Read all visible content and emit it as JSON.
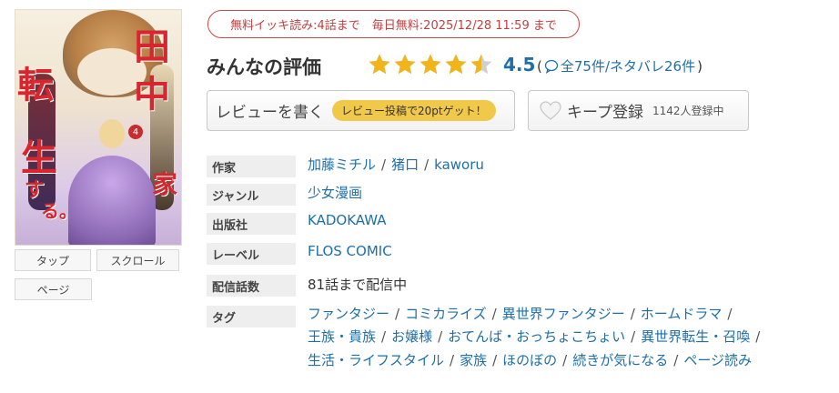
{
  "cover": {
    "title_chars": [
      "田",
      "中",
      "家",
      "転",
      "生",
      "す",
      "る。"
    ],
    "volume_badge": "4"
  },
  "view_buttons": [
    {
      "label": "タップ"
    },
    {
      "label": "スクロール"
    },
    {
      "label": "ページ"
    }
  ],
  "banner": {
    "text": "無料イッキ読み:4話まで　毎日無料:2025/12/28 11:59 まで"
  },
  "rating": {
    "title": "みんなの評価",
    "value": 4.5,
    "score_text": "4.5",
    "count_prefix": "(",
    "count_text": "全75件/ネタバレ26件",
    "count_suffix": ")"
  },
  "review_button": {
    "label": "レビューを書く",
    "badge": "レビュー投稿で20ptゲット！"
  },
  "keep_button": {
    "label": "キープ登録",
    "count": "1142人登録中"
  },
  "info": {
    "author": {
      "label": "作家",
      "names": [
        "加藤ミチル",
        "猪口",
        "kaworu"
      ]
    },
    "genre": {
      "label": "ジャンル",
      "value": "少女漫画"
    },
    "publisher": {
      "label": "出版社",
      "value": "KADOKAWA"
    },
    "imprint": {
      "label": "レーベル",
      "value": "FLOS COMIC"
    },
    "episodes": {
      "label": "配信話数",
      "value": "81話まで配信中"
    },
    "tags": {
      "label": "タグ",
      "lines": [
        [
          "ファンタジー",
          "コミカライズ",
          "異世界ファンタジー",
          "ホームドラマ"
        ],
        [
          "王族・貴族",
          "お嬢様",
          "おてんば・おっちょこちょい",
          "異世界転生・召喚"
        ],
        [
          "生活・ライフスタイル",
          "家族",
          "ほのぼの",
          "続きが気になる",
          "ページ読み"
        ]
      ]
    }
  },
  "colors": {
    "accent_link": "#1e6fa8",
    "banner_red": "#c23f3f",
    "star_gold": "#f1b51b",
    "star_empty": "#d0d0d0",
    "badge_yellow": "#f1c94a"
  }
}
